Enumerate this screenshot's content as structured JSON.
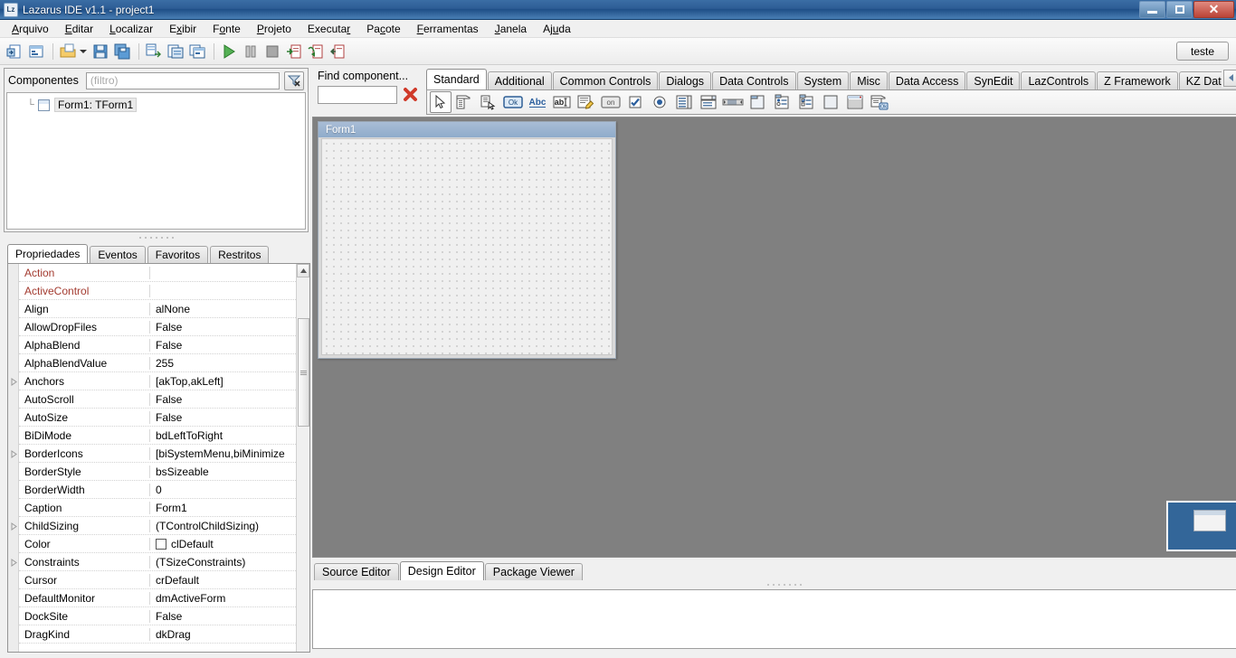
{
  "window": {
    "title": "Lazarus IDE v1.1 - project1",
    "icon": "lazarus-logo-icon",
    "controls": {
      "minimize": "minimize-icon",
      "maximize": "maximize-icon",
      "close": "close-icon"
    }
  },
  "menubar": {
    "items": [
      {
        "label": "Arquivo",
        "accel": "A"
      },
      {
        "label": "Editar",
        "accel": "E"
      },
      {
        "label": "Localizar",
        "accel": "L"
      },
      {
        "label": "Exibir",
        "accel": "x"
      },
      {
        "label": "Fonte",
        "accel": "o"
      },
      {
        "label": "Projeto",
        "accel": "P"
      },
      {
        "label": "Executar",
        "accel": "r"
      },
      {
        "label": "Pacote",
        "accel": "c"
      },
      {
        "label": "Ferramentas",
        "accel": "F"
      },
      {
        "label": "Janela",
        "accel": "J"
      },
      {
        "label": "Ajuda",
        "accel": "u"
      }
    ]
  },
  "toolbar": {
    "buttons": [
      {
        "name": "new-unit-icon",
        "tooltip": "New Unit"
      },
      {
        "name": "new-form-icon",
        "tooltip": "New Form"
      },
      {
        "name": "open-file-icon",
        "tooltip": "Open"
      },
      {
        "name": "open-dropdown-icon",
        "tooltip": "Open recent"
      },
      {
        "name": "save-icon",
        "tooltip": "Save"
      },
      {
        "name": "save-all-icon",
        "tooltip": "Save all"
      },
      {
        "name": "toggle-form-unit-icon",
        "tooltip": "Toggle form/unit"
      },
      {
        "name": "view-units-icon",
        "tooltip": "View units"
      },
      {
        "name": "view-forms-icon",
        "tooltip": "View forms"
      },
      {
        "name": "run-icon",
        "tooltip": "Run"
      },
      {
        "name": "pause-icon",
        "tooltip": "Pause"
      },
      {
        "name": "stop-icon",
        "tooltip": "Stop"
      },
      {
        "name": "step-into-icon",
        "tooltip": "Step into"
      },
      {
        "name": "step-over-icon",
        "tooltip": "Step over"
      },
      {
        "name": "step-out-icon",
        "tooltip": "Step out"
      }
    ],
    "right_button_label": "teste"
  },
  "components_panel": {
    "title": "Componentes",
    "filter_placeholder": "(filtro)",
    "filter_value": "",
    "clear_filter_icon": "clear-filter-icon",
    "tree": [
      {
        "label": "Form1: TForm1",
        "icon": "form-icon"
      }
    ]
  },
  "object_inspector": {
    "tabs": [
      {
        "label": "Propriedades",
        "active": true
      },
      {
        "label": "Eventos",
        "active": false
      },
      {
        "label": "Favoritos",
        "active": false
      },
      {
        "label": "Restritos",
        "active": false
      }
    ],
    "properties": [
      {
        "name": "Action",
        "value": "",
        "readonly": true,
        "expand": false,
        "swatch": null
      },
      {
        "name": "ActiveControl",
        "value": "",
        "readonly": true,
        "expand": false,
        "swatch": null
      },
      {
        "name": "Align",
        "value": "alNone",
        "readonly": false,
        "expand": false,
        "swatch": null
      },
      {
        "name": "AllowDropFiles",
        "value": "False",
        "readonly": false,
        "expand": false,
        "swatch": null
      },
      {
        "name": "AlphaBlend",
        "value": "False",
        "readonly": false,
        "expand": false,
        "swatch": null
      },
      {
        "name": "AlphaBlendValue",
        "value": "255",
        "readonly": false,
        "expand": false,
        "swatch": null
      },
      {
        "name": "Anchors",
        "value": "[akTop,akLeft]",
        "readonly": false,
        "expand": true,
        "swatch": null
      },
      {
        "name": "AutoScroll",
        "value": "False",
        "readonly": false,
        "expand": false,
        "swatch": null
      },
      {
        "name": "AutoSize",
        "value": "False",
        "readonly": false,
        "expand": false,
        "swatch": null
      },
      {
        "name": "BiDiMode",
        "value": "bdLeftToRight",
        "readonly": false,
        "expand": false,
        "swatch": null
      },
      {
        "name": "BorderIcons",
        "value": "[biSystemMenu,biMinimize",
        "readonly": false,
        "expand": true,
        "swatch": null
      },
      {
        "name": "BorderStyle",
        "value": "bsSizeable",
        "readonly": false,
        "expand": false,
        "swatch": null
      },
      {
        "name": "BorderWidth",
        "value": "0",
        "readonly": false,
        "expand": false,
        "swatch": null
      },
      {
        "name": "Caption",
        "value": "Form1",
        "readonly": false,
        "expand": false,
        "swatch": null
      },
      {
        "name": "ChildSizing",
        "value": "(TControlChildSizing)",
        "readonly": false,
        "expand": true,
        "swatch": null
      },
      {
        "name": "Color",
        "value": "clDefault",
        "readonly": false,
        "expand": false,
        "swatch": "#ffffff"
      },
      {
        "name": "Constraints",
        "value": "(TSizeConstraints)",
        "readonly": false,
        "expand": true,
        "swatch": null
      },
      {
        "name": "Cursor",
        "value": "crDefault",
        "readonly": false,
        "expand": false,
        "swatch": null
      },
      {
        "name": "DefaultMonitor",
        "value": "dmActiveForm",
        "readonly": false,
        "expand": false,
        "swatch": null
      },
      {
        "name": "DockSite",
        "value": "False",
        "readonly": false,
        "expand": false,
        "swatch": null
      },
      {
        "name": "DragKind",
        "value": "dkDrag",
        "readonly": false,
        "expand": false,
        "swatch": null
      }
    ]
  },
  "find_component": {
    "label": "Find component...",
    "value": "",
    "placeholder": "",
    "clear_icon": "red-x-icon"
  },
  "palette": {
    "tabs": [
      {
        "label": "Standard",
        "active": true
      },
      {
        "label": "Additional",
        "active": false
      },
      {
        "label": "Common Controls",
        "active": false
      },
      {
        "label": "Dialogs",
        "active": false
      },
      {
        "label": "Data Controls",
        "active": false
      },
      {
        "label": "System",
        "active": false
      },
      {
        "label": "Misc",
        "active": false
      },
      {
        "label": "Data Access",
        "active": false
      },
      {
        "label": "SynEdit",
        "active": false
      },
      {
        "label": "LazControls",
        "active": false
      },
      {
        "label": "Z Framework",
        "active": false
      },
      {
        "label": "KZ Data Contro",
        "active": false
      }
    ],
    "scroll_left_icon": "scroll-left-icon",
    "scroll_right_icon": "scroll-right-icon",
    "components": [
      {
        "name": "select-pointer-icon",
        "label": "TSelect",
        "selected": true
      },
      {
        "name": "tmainmenu-icon",
        "label": "TMainMenu",
        "selected": false
      },
      {
        "name": "tpopupmenu-icon",
        "label": "TPopupMenu",
        "selected": false
      },
      {
        "name": "tbutton-icon",
        "label": "TButton",
        "selected": false
      },
      {
        "name": "tlabel-icon",
        "label": "TLabel",
        "selected": false
      },
      {
        "name": "tedit-icon",
        "label": "TEdit",
        "selected": false
      },
      {
        "name": "tmemo-icon",
        "label": "TMemo",
        "selected": false
      },
      {
        "name": "ttogglebox-icon",
        "label": "TToggleBox",
        "selected": false
      },
      {
        "name": "tcheckbox-icon",
        "label": "TCheckBox",
        "selected": false
      },
      {
        "name": "tradiobutton-icon",
        "label": "TRadioButton",
        "selected": false
      },
      {
        "name": "tlistbox-icon",
        "label": "TListBox",
        "selected": false
      },
      {
        "name": "tcombobox-icon",
        "label": "TComboBox",
        "selected": false
      },
      {
        "name": "tscrollbar-icon",
        "label": "TScrollBar",
        "selected": false
      },
      {
        "name": "tgroupbox-icon",
        "label": "TGroupBox",
        "selected": false
      },
      {
        "name": "tradiogroup-icon",
        "label": "TRadioGroup",
        "selected": false
      },
      {
        "name": "tcheckgroup-icon",
        "label": "TCheckGroup",
        "selected": false
      },
      {
        "name": "tpanel-icon",
        "label": "TPanel",
        "selected": false
      },
      {
        "name": "tframe-icon",
        "label": "TFrame",
        "selected": false
      },
      {
        "name": "tactionlist-icon",
        "label": "TActionList",
        "selected": false
      }
    ]
  },
  "designer": {
    "form": {
      "caption": "Form1"
    },
    "screen_thumbnail": "screen-preview-thumbnail"
  },
  "bottom_tabs": [
    {
      "label": "Source Editor",
      "active": false
    },
    {
      "label": "Design Editor",
      "active": true
    },
    {
      "label": "Package Viewer",
      "active": false
    }
  ],
  "messages": {
    "lines": []
  },
  "colors": {
    "titlebar": "#2d5c95",
    "designer_background": "#808080",
    "form_caption": "#8faccb",
    "readonly_property": "#a33b30",
    "thumbnail_blue": "#336699"
  }
}
